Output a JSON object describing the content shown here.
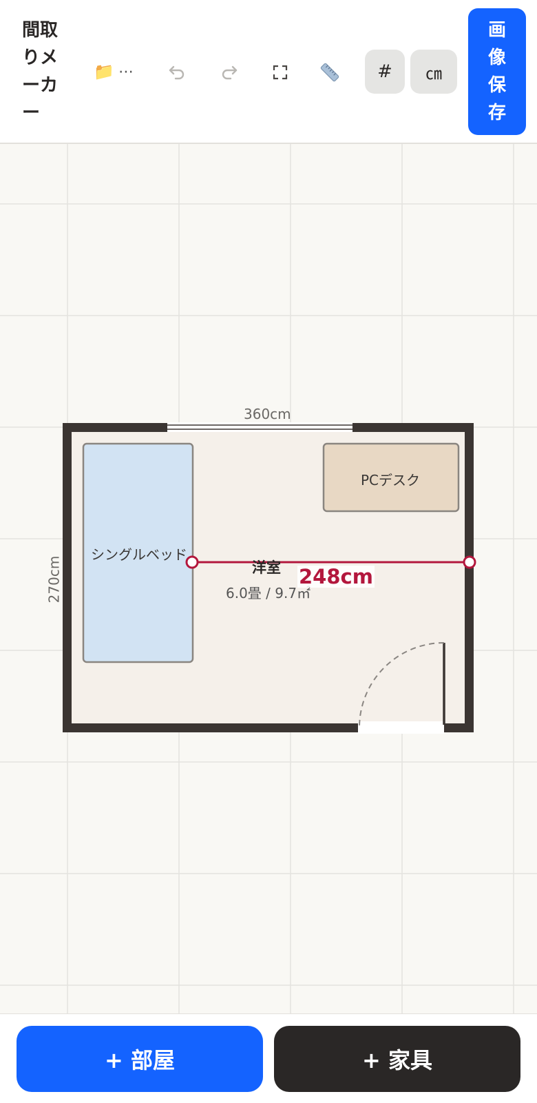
{
  "toolbar": {
    "app_title": "間取りメーカー",
    "file_icon": "folder-icon",
    "file_more": "⋯",
    "undo_icon": "undo-arrow-icon",
    "redo_icon": "redo-arrow-icon",
    "fit_icon": "fit-to-screen-icon",
    "ruler_icon": "ruler-icon",
    "grid_toggle_label": "#",
    "unit_toggle_label": "㎝",
    "save_label": "画像保存"
  },
  "floor_plan": {
    "room": {
      "name": "洋室",
      "area_text": "6.0畳 / 9.7㎡",
      "width_label": "360cm",
      "height_label": "270cm"
    },
    "furniture": [
      {
        "name": "シングルベッド",
        "color": "#d2e3f3"
      },
      {
        "name": "PCデスク",
        "color": "#e8d8c4"
      }
    ],
    "measurement": {
      "value_label": "248cm",
      "color": "#b3173d"
    }
  },
  "bottom_bar": {
    "add_room_label": "+ 部屋",
    "add_furniture_label": "+ 家具"
  },
  "colors": {
    "accent": "#1463ff",
    "wall": "#3b3532",
    "floor": "#f5f0ea",
    "grid": "#e4e3df"
  }
}
